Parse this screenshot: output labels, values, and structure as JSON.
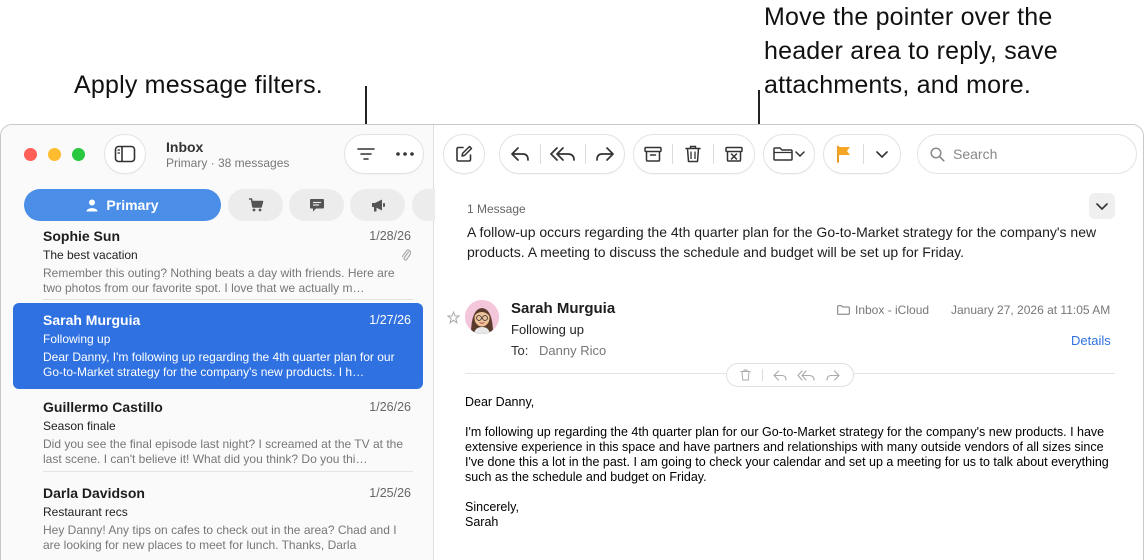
{
  "callouts": {
    "filters": "Apply message filters.",
    "header": "Move the pointer over the header area to reply, save attachments, and more."
  },
  "mailbox": {
    "title": "Inbox",
    "subtitle": "Primary · 38 messages"
  },
  "categories": {
    "primary_label": "Primary"
  },
  "messages": [
    {
      "from": "Sophie Sun",
      "date": "1/28/26",
      "subject": "The best vacation",
      "preview": "Remember this outing? Nothing beats a day with friends. Here are two photos from our favorite spot. I love that we actually m…"
    },
    {
      "from": "Sarah Murguia",
      "date": "1/27/26",
      "subject": "Following up",
      "preview": "Dear Danny, I'm following up regarding the 4th quarter plan for our Go-to-Market strategy for the company's new products. I h…"
    },
    {
      "from": "Guillermo Castillo",
      "date": "1/26/26",
      "subject": "Season finale",
      "preview": "Did you see the final episode last night? I screamed at the TV at the last scene. I can't believe it! What did you think? Do you thi…"
    },
    {
      "from": "Darla Davidson",
      "date": "1/25/26",
      "subject": "Restaurant recs",
      "preview": "Hey Danny! Any tips on cafes to check out in the area? Chad and I are looking for new places to meet for lunch. Thanks, Darla"
    }
  ],
  "search": {
    "placeholder": "Search"
  },
  "reading": {
    "thread_count": "1 Message",
    "summary": "A follow-up occurs regarding the 4th quarter plan for the Go-to-Market strategy for the company's new products. A meeting to discuss the schedule and budget will be set up for Friday.",
    "sender": "Sarah Murguia",
    "subject": "Following up",
    "to_label": "To:",
    "to_value": "Danny Rico",
    "mailbox": "Inbox - iCloud",
    "date": "January 27, 2026 at 11:05 AM",
    "details_label": "Details",
    "greeting": "Dear Danny,",
    "body": "I'm following up regarding the 4th quarter plan for our Go-to-Market strategy for the company's new products. I have extensive experience in this space and have partners and relationships with many outside vendors of all sizes since I've done this a lot in the past. I am going to check your calendar and set up a meeting for us to talk about everything such as the schedule and budget on Friday.",
    "signoff": "Sincerely,\nSarah"
  },
  "colors": {
    "accent": "#2f71e0",
    "primary_tab": "#4a8ee8",
    "flag": "#f5a623"
  }
}
